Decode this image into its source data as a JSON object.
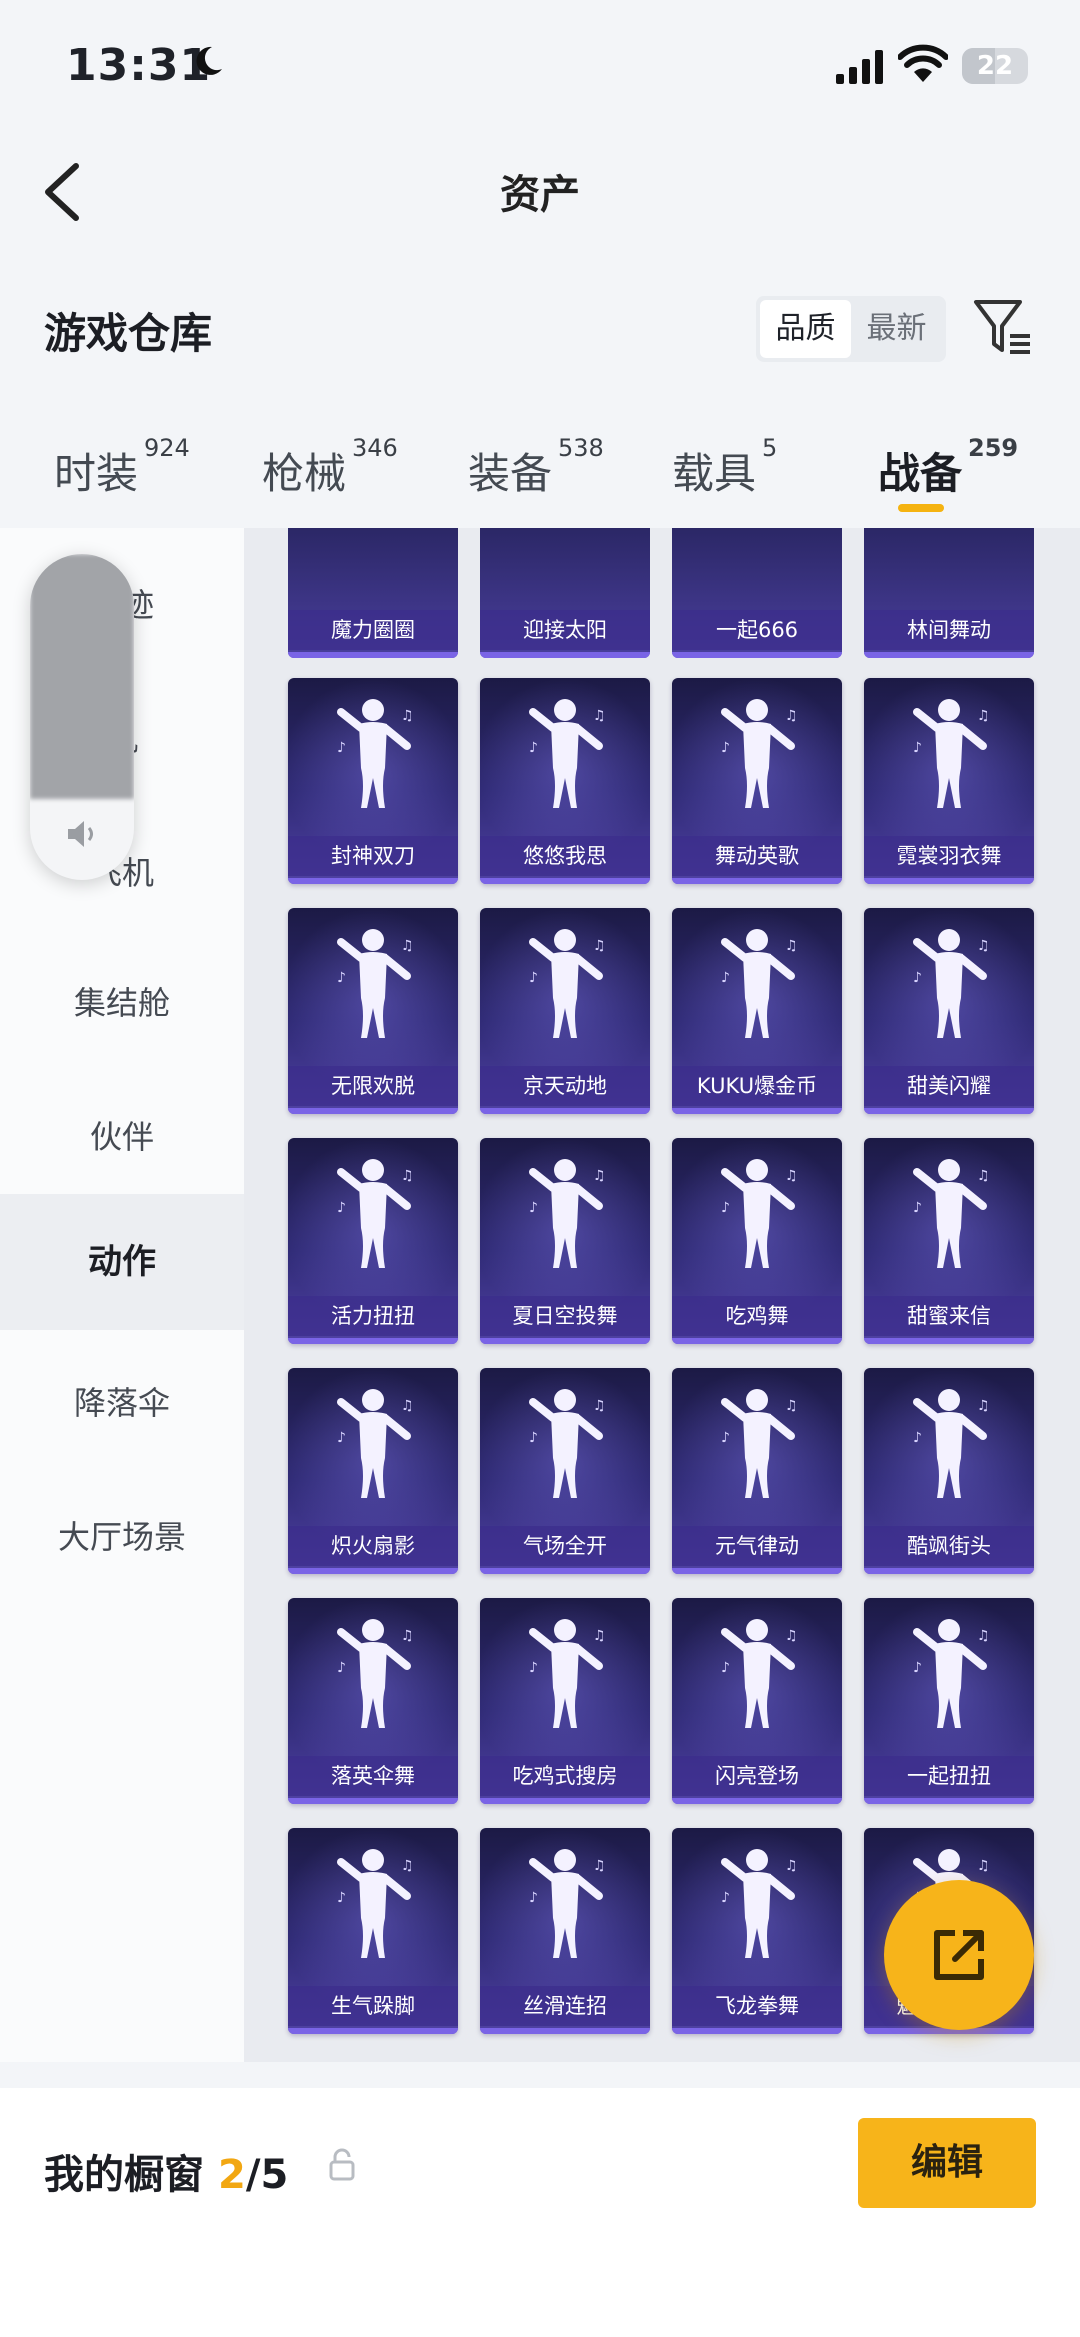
{
  "status_bar": {
    "time": "13:31",
    "battery": "22"
  },
  "header": {
    "title": "资产",
    "section_title": "游戏仓库"
  },
  "sort": {
    "options": [
      "品质",
      "最新"
    ],
    "active": "品质"
  },
  "tabs": [
    {
      "label": "时装",
      "count": "924"
    },
    {
      "label": "枪械",
      "count": "346"
    },
    {
      "label": "装备",
      "count": "538"
    },
    {
      "label": "载具",
      "count": "5"
    },
    {
      "label": "战备",
      "count": "259",
      "active": true
    }
  ],
  "sidebar": {
    "items": [
      "尾迹",
      "机",
      "飞机",
      "集结舱",
      "伙伴",
      "动作",
      "降落伞",
      "大厅场景"
    ],
    "active": "动作"
  },
  "items_row0": [
    "魔力圈圈",
    "迎接太阳",
    "一起666",
    "林间舞动"
  ],
  "items": [
    [
      "封神双刀",
      "悠悠我思",
      "舞动英歌",
      "霓裳羽衣舞"
    ],
    [
      "无限欢脱",
      "京天动地",
      "KUKU爆金币",
      "甜美闪耀"
    ],
    [
      "活力扭扭",
      "夏日空投舞",
      "吃鸡舞",
      "甜蜜来信"
    ],
    [
      "炽火扇影",
      "气场全开",
      "元气律动",
      "酷飒街头"
    ],
    [
      "落英伞舞",
      "吃鸡式搜房",
      "闪亮登场",
      "一起扭扭"
    ],
    [
      "生气跺脚",
      "丝滑连招",
      "飞龙拳舞",
      "魅力四射舞"
    ]
  ],
  "bottom": {
    "showcase_label": "我的橱窗",
    "current": "2",
    "separator": "/",
    "total": "5",
    "edit_label": "编辑"
  },
  "colors": {
    "accent": "#f7b41a",
    "card_top": "#1c1a45",
    "card_bottom": "#5042a4"
  }
}
